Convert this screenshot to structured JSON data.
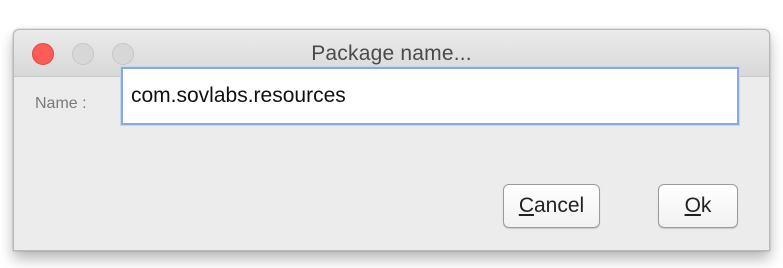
{
  "window": {
    "title": "Package name..."
  },
  "form": {
    "name_label": "Name :",
    "name_value": "com.sovlabs.resources"
  },
  "buttons": {
    "cancel_mnemonic": "C",
    "cancel_rest": "ancel",
    "ok_mnemonic": "O",
    "ok_rest": "k"
  },
  "colors": {
    "close_button": "#fd5c56",
    "inactive_traffic": "#d7d7d7",
    "input_focus_border": "#86abdc"
  },
  "icons": {
    "close": "close-icon",
    "minimize": "minimize-icon",
    "maximize": "maximize-icon"
  }
}
